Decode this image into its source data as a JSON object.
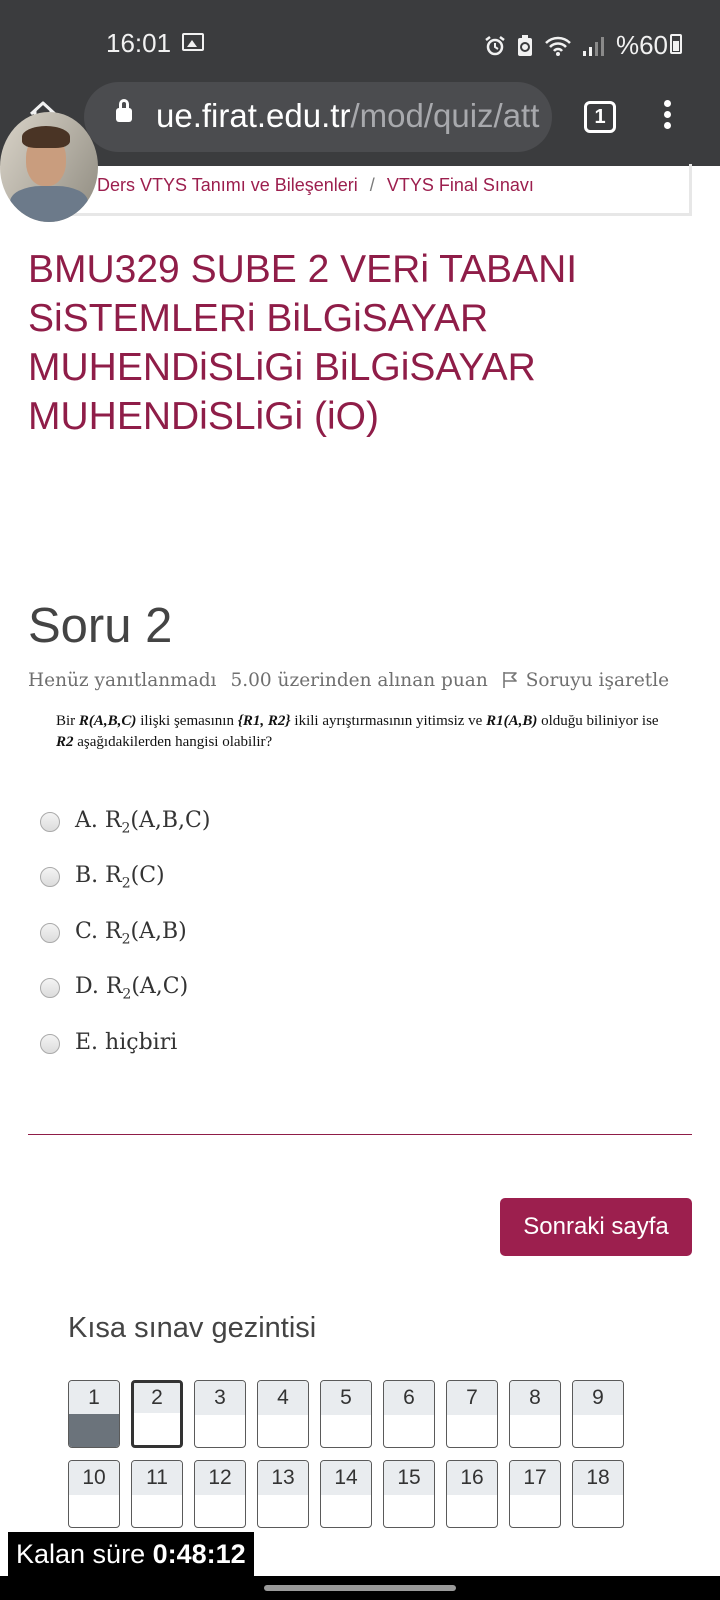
{
  "status_bar": {
    "time": "16:01",
    "battery": "%60",
    "icons": [
      "gallery-icon",
      "alarm-icon",
      "recycle-icon",
      "wifi-icon",
      "signal-icon",
      "battery-icon"
    ]
  },
  "browser": {
    "url_host": "ue.firat.edu.tr",
    "url_path": "/mod/quiz/att",
    "tab_count": "1"
  },
  "breadcrumb": {
    "items": [
      "1. Ders VTYS Tanımı ve Bileşenleri",
      "VTYS Final Sınavı"
    ],
    "separator": "/"
  },
  "course_title": "BMU329 SUBE 2 VERi TABANI SiSTEMLERi BiLGiSAYAR MUHENDiSLiGi BiLGiSAYAR MUHENDiSLiGi (iO)",
  "question": {
    "number_label": "Soru 2",
    "state": "Henüz yanıtlanmadı",
    "grade": "5.00 üzerinden alınan puan",
    "flag_label": "Soruyu işaretle",
    "text_before_1": "Bir ",
    "relation": "R(A,B,C)",
    "text_before_2": " ilişki şemasının ",
    "decomposition": "{R1, R2}",
    "text_before_3": "  ikili ayrıştırmasının yitimsiz ve ",
    "r1": "R1(A,B)",
    "text_before_4": " olduğu biliniyor ise ",
    "r2": "R2",
    "text_after": " aşağıdakilerden hangisi olabilir?",
    "answers": [
      {
        "letter": "A. R",
        "sub": "2",
        "rest": "(A,B,C)"
      },
      {
        "letter": "B. R",
        "sub": "2",
        "rest": "(C)"
      },
      {
        "letter": "C. R",
        "sub": "2",
        "rest": "(A,B)"
      },
      {
        "letter": "D. R",
        "sub": "2",
        "rest": "(A,C)"
      },
      {
        "letter": "E. hiçbiri",
        "sub": "",
        "rest": ""
      }
    ]
  },
  "next_button": "Sonraki sayfa",
  "navigation": {
    "title": "Kısa sınav gezintisi",
    "buttons": [
      "1",
      "2",
      "3",
      "4",
      "5",
      "6",
      "7",
      "8",
      "9",
      "10",
      "11",
      "12",
      "13",
      "14",
      "15",
      "16",
      "17",
      "18"
    ],
    "answered": [
      "1"
    ],
    "current": "2"
  },
  "timer": {
    "label": "Kalan süre ",
    "value": "0:48:12"
  }
}
